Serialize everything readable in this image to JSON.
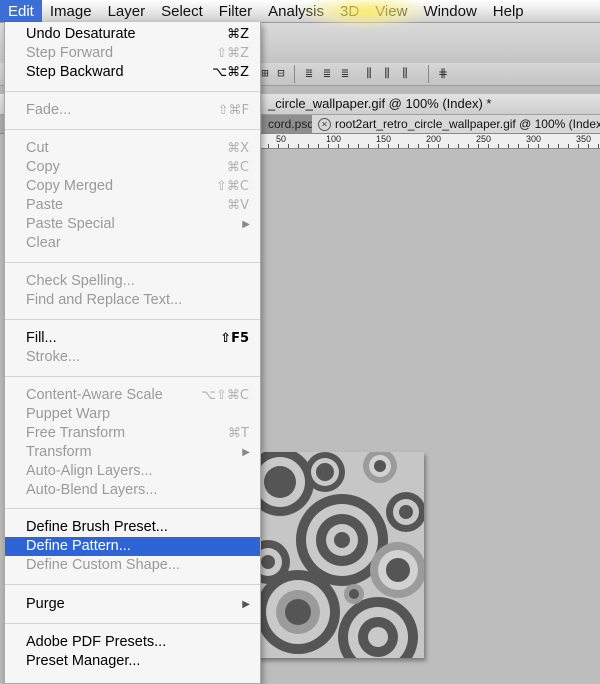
{
  "menubar": {
    "items": [
      {
        "label": "Edit",
        "active": true
      },
      {
        "label": "Image"
      },
      {
        "label": "Layer"
      },
      {
        "label": "Select"
      },
      {
        "label": "Filter"
      },
      {
        "label": "Analysis"
      },
      {
        "label": "3D"
      },
      {
        "label": "View"
      },
      {
        "label": "Window"
      },
      {
        "label": "Help"
      }
    ]
  },
  "document": {
    "window_title": "_circle_wallpaper.gif @ 100% (Index) *",
    "tabs": [
      {
        "label": "cord.psd"
      },
      {
        "label": "root2art_retro_circle_wallpaper.gif @ 100% (Index)"
      }
    ],
    "ruler_labels": [
      "50",
      "100",
      "150",
      "200",
      "250",
      "300",
      "350"
    ]
  },
  "edit_menu": {
    "items": [
      {
        "label": "Undo Desaturate",
        "shortcut": "⌘Z",
        "enabled": true
      },
      {
        "label": "Step Forward",
        "shortcut": "⇧⌘Z",
        "enabled": false
      },
      {
        "label": "Step Backward",
        "shortcut": "⌥⌘Z",
        "enabled": true
      },
      {
        "label": "Fade...",
        "shortcut": "⇧⌘F",
        "enabled": false
      },
      {
        "label": "Cut",
        "shortcut": "⌘X",
        "enabled": false
      },
      {
        "label": "Copy",
        "shortcut": "⌘C",
        "enabled": false
      },
      {
        "label": "Copy Merged",
        "shortcut": "⇧⌘C",
        "enabled": false
      },
      {
        "label": "Paste",
        "shortcut": "⌘V",
        "enabled": false
      },
      {
        "label": "Paste Special",
        "shortcut": "",
        "enabled": false,
        "submenu": true
      },
      {
        "label": "Clear",
        "shortcut": "",
        "enabled": false
      },
      {
        "label": "Check Spelling...",
        "shortcut": "",
        "enabled": false
      },
      {
        "label": "Find and Replace Text...",
        "shortcut": "",
        "enabled": false
      },
      {
        "label": "Fill...",
        "shortcut": "⇧F5",
        "enabled": true
      },
      {
        "label": "Stroke...",
        "shortcut": "",
        "enabled": false
      },
      {
        "label": "Content-Aware Scale",
        "shortcut": "⌥⇧⌘C",
        "enabled": false
      },
      {
        "label": "Puppet Warp",
        "shortcut": "",
        "enabled": false
      },
      {
        "label": "Free Transform",
        "shortcut": "⌘T",
        "enabled": false
      },
      {
        "label": "Transform",
        "shortcut": "",
        "enabled": false,
        "submenu": true
      },
      {
        "label": "Auto-Align Layers...",
        "shortcut": "",
        "enabled": false
      },
      {
        "label": "Auto-Blend Layers...",
        "shortcut": "",
        "enabled": false
      },
      {
        "label": "Define Brush Preset...",
        "shortcut": "",
        "enabled": true
      },
      {
        "label": "Define Pattern...",
        "shortcut": "",
        "enabled": true,
        "highlighted": true
      },
      {
        "label": "Define Custom Shape...",
        "shortcut": "",
        "enabled": false
      },
      {
        "label": "Purge",
        "shortcut": "",
        "enabled": true,
        "submenu": true
      },
      {
        "label": "Adobe PDF Presets...",
        "shortcut": "",
        "enabled": true
      },
      {
        "label": "Preset Manager...",
        "shortcut": "",
        "enabled": true
      }
    ]
  },
  "colors": {
    "highlight": "#2f64d6",
    "menu_bg": "#f6f6f6",
    "disabled_text": "#9a9a9a"
  }
}
